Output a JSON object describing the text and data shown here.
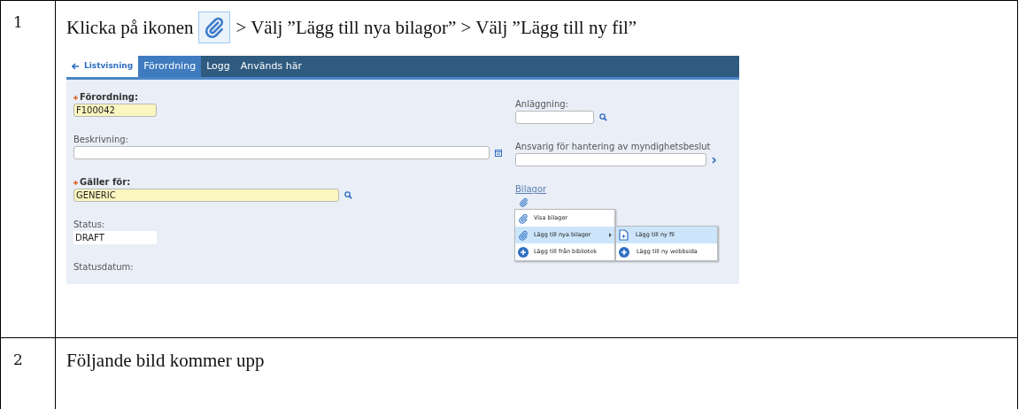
{
  "steps": [
    {
      "number": "1",
      "instruction": {
        "before": "Klicka på ikonen",
        "after": "> Välj ”Lägg till nya bilagor” > Välj ”Lägg till ny fil”"
      },
      "screenshot": {
        "tabs": [
          {
            "label": "Listvisning",
            "kind": "back",
            "selected": false
          },
          {
            "label": "Förordning",
            "kind": "tab",
            "selected": true
          },
          {
            "label": "Logg",
            "kind": "tab",
            "selected": false
          },
          {
            "label": "Används här",
            "kind": "tab",
            "selected": false
          }
        ],
        "left_fields": [
          {
            "label": "Förordning:",
            "required": true,
            "value": "F100042",
            "kind": "input"
          },
          {
            "label": "Beskrivning:",
            "required": false,
            "kind": "input"
          },
          {
            "label": "Gäller för:",
            "required": true,
            "value": "GENERIC",
            "kind": "input"
          },
          {
            "label": "Status:",
            "required": false,
            "value": "DRAFT",
            "kind": "readonly"
          },
          {
            "label": "Statusdatum:",
            "required": false,
            "kind": "label"
          }
        ],
        "right_fields": [
          {
            "label": "Anläggning:",
            "required": false,
            "kind": "input"
          },
          {
            "label": "Ansvarig för hantering av myndighetsbeslut",
            "required": false,
            "kind": "input"
          }
        ],
        "attachments": {
          "link": "Bilagor",
          "menu": [
            {
              "label": "Visa bilagor",
              "selected": false,
              "has_submenu": false
            },
            {
              "label": "Lägg till nya bilagor",
              "selected": true,
              "has_submenu": true
            },
            {
              "label": "Lägg till från bibliotek",
              "selected": false,
              "has_submenu": false
            }
          ],
          "submenu": [
            {
              "label": "Lägg till ny fil",
              "selected": true
            },
            {
              "label": "Lägg till ny webbsida",
              "selected": false
            }
          ]
        }
      }
    },
    {
      "number": "2",
      "text": "Följande bild kommer upp"
    }
  ]
}
